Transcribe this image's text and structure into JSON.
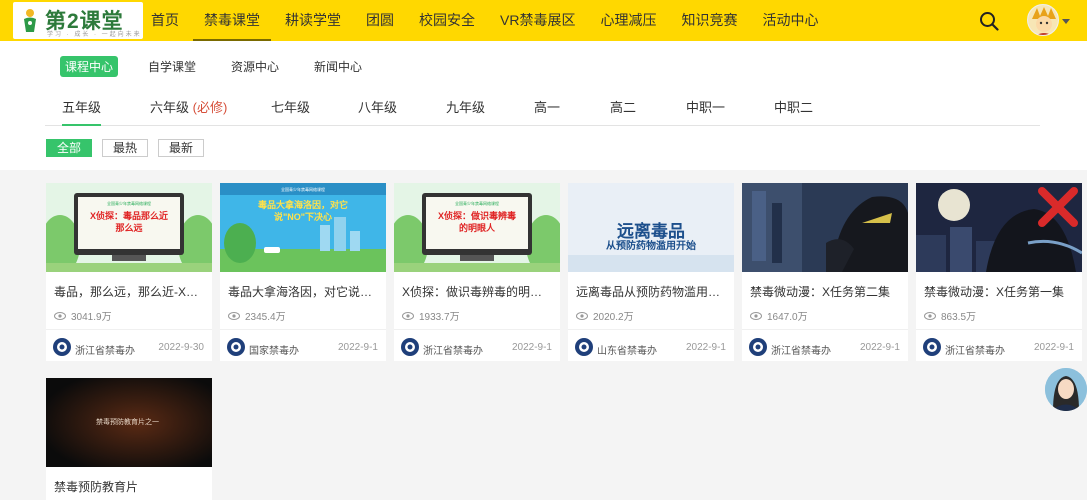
{
  "logo": {
    "name": "第2课堂",
    "slogan": "学习  ·  成长  ·  一起向未来"
  },
  "nav": {
    "items": [
      {
        "label": "首页"
      },
      {
        "label": "禁毒课堂",
        "active": true
      },
      {
        "label": "耕读学堂"
      },
      {
        "label": "团圆"
      },
      {
        "label": "校园安全"
      },
      {
        "label": "VR禁毒展区"
      },
      {
        "label": "心理减压"
      },
      {
        "label": "知识竞赛"
      },
      {
        "label": "活动中心"
      }
    ],
    "search_icon": "search-icon",
    "avatar_icon": "user-avatar"
  },
  "sub_tabs": [
    {
      "label": "课程中心",
      "active": true
    },
    {
      "label": "自学课堂"
    },
    {
      "label": "资源中心"
    },
    {
      "label": "新闻中心"
    }
  ],
  "grades": [
    {
      "label": "五年级",
      "active": true
    },
    {
      "label": "六年级",
      "note": "(必修)"
    },
    {
      "label": "七年级"
    },
    {
      "label": "八年级"
    },
    {
      "label": "九年级"
    },
    {
      "label": "高一"
    },
    {
      "label": "高二"
    },
    {
      "label": "中职一"
    },
    {
      "label": "中职二"
    }
  ],
  "sorts": [
    {
      "label": "全部",
      "active": true
    },
    {
      "label": "最热"
    },
    {
      "label": "最新"
    }
  ],
  "cards": [
    {
      "title": "毒品，那么远，那么近-X侦探",
      "views": "3041.9万",
      "org": "浙江省禁毒办",
      "date": "2022-9-30",
      "thumb_text": "X侦探：毒品那么近那么远",
      "thumb_caption": "全国青少年禁毒网络课程"
    },
    {
      "title": "毒品大拿海洛因，对它说NO下决心",
      "views": "2345.4万",
      "org": "国家禁毒办",
      "date": "2022-9-1",
      "thumb_text": "毒品大拿海洛因，对它说\"NO\"下决心",
      "thumb_caption": "全国青少年禁毒网络课程"
    },
    {
      "title": "X侦探：做识毒辨毒的明眼人",
      "views": "1933.7万",
      "org": "浙江省禁毒办",
      "date": "2022-9-1",
      "thumb_text": "X侦探：做识毒辨毒的明眼人",
      "thumb_caption": "全国青少年禁毒网络课程"
    },
    {
      "title": "远离毒品从预防药物滥用开始",
      "views": "2020.2万",
      "org": "山东省禁毒办",
      "date": "2022-9-1",
      "thumb_text": "远离毒品",
      "thumb_sub": "从预防药物滥用开始"
    },
    {
      "title": "禁毒微动漫：X任务第二集",
      "views": "1647.0万",
      "org": "浙江省禁毒办",
      "date": "2022-9-1"
    },
    {
      "title": "禁毒微动漫：X任务第一集",
      "views": "863.5万",
      "org": "浙江省禁毒办",
      "date": "2022-9-1"
    },
    {
      "title": "禁毒预防教育片",
      "thumb_text": "禁毒预防教育片之一"
    }
  ],
  "colors": {
    "header": "#ffd800",
    "accent": "#36c46b",
    "required": "#d64f3a"
  },
  "helper_icon": "customer-service-avatar"
}
